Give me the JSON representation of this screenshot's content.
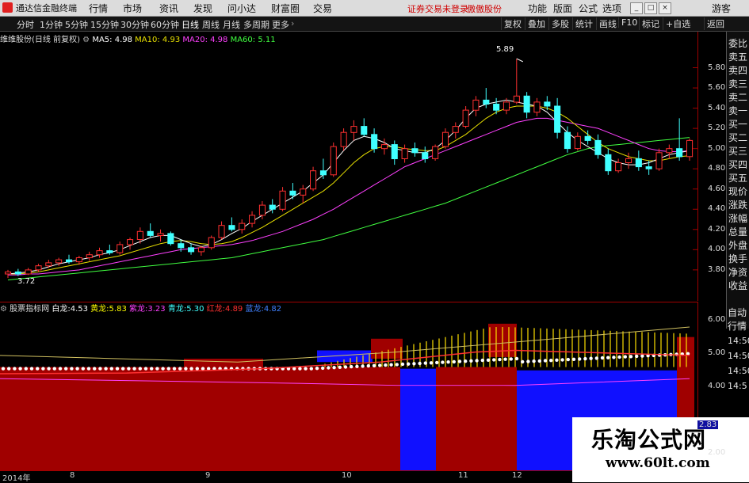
{
  "menubar": {
    "app_title": "通达信金融终端",
    "items": [
      "行情",
      "市场",
      "资讯",
      "发现",
      "问小达",
      "财富圈",
      "交易"
    ],
    "notice": "证券交易未登录",
    "stock_hint": "傲傲股份",
    "right_items": [
      "功能",
      "版面",
      "公式",
      "选项"
    ],
    "guest": "游客"
  },
  "periodbar": {
    "periods": [
      "分时",
      "1分钟",
      "5分钟",
      "15分钟",
      "30分钟",
      "60分钟",
      "日线",
      "周线",
      "月线",
      "多周期",
      "更多"
    ],
    "active": "日线",
    "tools": [
      "复权",
      "叠加",
      "多股",
      "统计",
      "画线",
      "F10",
      "标记",
      "+自选",
      "返回"
    ]
  },
  "side_panel": [
    "委比",
    "卖五",
    "卖四",
    "卖三",
    "卖二",
    "卖一",
    "买一",
    "买二",
    "买三",
    "买四",
    "买五",
    "现价",
    "涨跌",
    "涨幅",
    "总量",
    "外盘",
    "换手",
    "净资",
    "收益"
  ],
  "side_panel2": [
    "自动",
    "行情"
  ],
  "side_times": [
    "14:50",
    "14:50",
    "14:50",
    "14:5"
  ],
  "main_legend": {
    "name": "维维股份(日线 前复权)",
    "ma5_label": "MA5: 4.98",
    "ma10_label": "MA10: 4.93",
    "ma20_label": "MA20: 4.98",
    "ma60_label": "MA60: 5.11",
    "colors": {
      "ma5": "#ffffff",
      "ma10": "#e8e000",
      "ma20": "#ff40ff",
      "ma60": "#40ff40"
    }
  },
  "price_axis": [
    "5.80",
    "5.60",
    "5.40",
    "5.20",
    "5.00",
    "4.80",
    "4.60",
    "4.40",
    "4.20",
    "4.00",
    "3.80"
  ],
  "annotations": {
    "high": "5.89",
    "low": "3.72"
  },
  "indicator_legend": {
    "name": "股票指标网",
    "items": [
      {
        "label": "白龙:",
        "value": "4.53",
        "color": "#ffffff"
      },
      {
        "label": "黄龙:",
        "value": "5.83",
        "color": "#ffff00"
      },
      {
        "label": "紫龙:",
        "value": "3.23",
        "color": "#ff40ff"
      },
      {
        "label": "青龙:",
        "value": "5.30",
        "color": "#40ffff"
      },
      {
        "label": "红龙:",
        "value": "4.89",
        "color": "#ff3030"
      },
      {
        "label": "蓝龙:",
        "value": "4.82",
        "color": "#4080ff"
      }
    ]
  },
  "indicator_axis": [
    "6.00",
    "5.00",
    "4.00",
    "2.83",
    "2.00"
  ],
  "dates": [
    "2014年",
    "8",
    "9",
    "10",
    "11",
    "12"
  ],
  "watermark": {
    "title": "乐淘公式网",
    "url": "www.60lt.com"
  },
  "chart_data": {
    "type": "candlestick",
    "ylim": [
      3.65,
      6.0
    ],
    "up_color": "#ff3030",
    "down_color": "#40ffff",
    "ohlc": [
      [
        3.76,
        3.8,
        3.72,
        3.78
      ],
      [
        3.78,
        3.81,
        3.74,
        3.76
      ],
      [
        3.76,
        3.82,
        3.75,
        3.8
      ],
      [
        3.8,
        3.86,
        3.78,
        3.84
      ],
      [
        3.84,
        3.9,
        3.82,
        3.87
      ],
      [
        3.87,
        3.92,
        3.84,
        3.9
      ],
      [
        3.9,
        3.95,
        3.86,
        3.88
      ],
      [
        3.88,
        3.94,
        3.85,
        3.92
      ],
      [
        3.92,
        3.98,
        3.89,
        3.95
      ],
      [
        3.95,
        4.02,
        3.92,
        3.99
      ],
      [
        3.99,
        4.05,
        3.95,
        3.97
      ],
      [
        3.97,
        4.08,
        3.95,
        4.05
      ],
      [
        4.05,
        4.12,
        4.0,
        4.1
      ],
      [
        4.1,
        4.22,
        4.06,
        4.18
      ],
      [
        4.18,
        4.26,
        4.12,
        4.14
      ],
      [
        4.14,
        4.2,
        4.08,
        4.16
      ],
      [
        4.16,
        4.18,
        4.04,
        4.06
      ],
      [
        4.06,
        4.1,
        3.98,
        4.02
      ],
      [
        4.02,
        4.06,
        3.95,
        3.98
      ],
      [
        3.98,
        4.04,
        3.94,
        4.02
      ],
      [
        4.02,
        4.14,
        4.0,
        4.12
      ],
      [
        4.12,
        4.28,
        4.1,
        4.24
      ],
      [
        4.24,
        4.32,
        4.18,
        4.2
      ],
      [
        4.2,
        4.3,
        4.16,
        4.26
      ],
      [
        4.26,
        4.38,
        4.22,
        4.34
      ],
      [
        4.34,
        4.48,
        4.3,
        4.44
      ],
      [
        4.44,
        4.5,
        4.36,
        4.4
      ],
      [
        4.4,
        4.62,
        4.38,
        4.58
      ],
      [
        4.58,
        4.66,
        4.5,
        4.54
      ],
      [
        4.54,
        4.64,
        4.46,
        4.6
      ],
      [
        4.6,
        4.82,
        4.58,
        4.78
      ],
      [
        4.78,
        4.9,
        4.7,
        4.74
      ],
      [
        4.74,
        5.06,
        4.72,
        5.02
      ],
      [
        5.02,
        5.2,
        4.98,
        5.16
      ],
      [
        5.16,
        5.28,
        5.08,
        5.22
      ],
      [
        5.22,
        5.3,
        5.12,
        5.14
      ],
      [
        5.14,
        5.2,
        4.96,
        5.0
      ],
      [
        5.0,
        5.1,
        4.94,
        5.04
      ],
      [
        5.04,
        5.08,
        4.84,
        4.9
      ],
      [
        4.9,
        5.04,
        4.86,
        5.0
      ],
      [
        5.0,
        5.06,
        4.92,
        4.96
      ],
      [
        4.96,
        5.02,
        4.86,
        4.9
      ],
      [
        4.9,
        5.04,
        4.88,
        5.02
      ],
      [
        5.02,
        5.2,
        5.0,
        5.16
      ],
      [
        5.16,
        5.26,
        5.1,
        5.22
      ],
      [
        5.22,
        5.42,
        5.2,
        5.38
      ],
      [
        5.38,
        5.52,
        5.32,
        5.48
      ],
      [
        5.48,
        5.6,
        5.4,
        5.44
      ],
      [
        5.44,
        5.5,
        5.34,
        5.38
      ],
      [
        5.38,
        5.5,
        5.34,
        5.46
      ],
      [
        5.46,
        5.89,
        5.44,
        5.52
      ],
      [
        5.52,
        5.56,
        5.3,
        5.36
      ],
      [
        5.36,
        5.5,
        5.32,
        5.46
      ],
      [
        5.46,
        5.52,
        5.38,
        5.42
      ],
      [
        5.42,
        5.5,
        5.1,
        5.16
      ],
      [
        5.16,
        5.22,
        4.96,
        5.0
      ],
      [
        5.0,
        5.16,
        4.98,
        5.12
      ],
      [
        5.12,
        5.18,
        5.04,
        5.08
      ],
      [
        5.08,
        5.14,
        4.9,
        4.94
      ],
      [
        4.94,
        5.0,
        4.74,
        4.78
      ],
      [
        4.78,
        4.9,
        4.76,
        4.86
      ],
      [
        4.86,
        4.96,
        4.8,
        4.9
      ],
      [
        4.9,
        4.98,
        4.78,
        4.82
      ],
      [
        4.82,
        4.88,
        4.74,
        4.8
      ],
      [
        4.8,
        5.0,
        4.78,
        4.96
      ],
      [
        4.96,
        5.04,
        4.9,
        5.0
      ],
      [
        5.0,
        5.3,
        4.88,
        4.92
      ],
      [
        4.92,
        5.1,
        4.88,
        5.08
      ]
    ],
    "ma": {
      "ma5": [
        3.76,
        3.77,
        3.78,
        3.8,
        3.83,
        3.86,
        3.88,
        3.9,
        3.92,
        3.95,
        3.97,
        4.0,
        4.04,
        4.08,
        4.12,
        4.14,
        4.14,
        4.1,
        4.06,
        4.03,
        4.05,
        4.1,
        4.16,
        4.21,
        4.28,
        4.34,
        4.4,
        4.46,
        4.52,
        4.58,
        4.66,
        4.74,
        4.86,
        4.98,
        5.08,
        5.12,
        5.1,
        5.06,
        5.0,
        4.98,
        4.96,
        4.96,
        5.0,
        5.08,
        5.18,
        5.3,
        5.4,
        5.44,
        5.46,
        5.48,
        5.46,
        5.44,
        5.42,
        5.36,
        5.26,
        5.16,
        5.08,
        5.02,
        4.96,
        4.9,
        4.86,
        4.84,
        4.84,
        4.86,
        4.9,
        4.94,
        4.96,
        4.98
      ],
      "ma10": [
        3.76,
        3.76,
        3.77,
        3.78,
        3.8,
        3.82,
        3.84,
        3.86,
        3.88,
        3.9,
        3.92,
        3.94,
        3.97,
        4.0,
        4.03,
        4.06,
        4.08,
        4.09,
        4.08,
        4.06,
        4.05,
        4.06,
        4.08,
        4.12,
        4.17,
        4.22,
        4.28,
        4.34,
        4.4,
        4.46,
        4.52,
        4.58,
        4.66,
        4.76,
        4.86,
        4.94,
        5.0,
        5.02,
        5.02,
        5.0,
        4.99,
        4.98,
        4.98,
        5.02,
        5.08,
        5.14,
        5.22,
        5.3,
        5.36,
        5.4,
        5.42,
        5.42,
        5.42,
        5.4,
        5.36,
        5.3,
        5.22,
        5.14,
        5.06,
        5.0,
        4.96,
        4.92,
        4.9,
        4.88,
        4.88,
        4.9,
        4.92,
        4.93
      ],
      "ma20": [
        3.75,
        3.75,
        3.76,
        3.76,
        3.77,
        3.78,
        3.79,
        3.8,
        3.82,
        3.84,
        3.86,
        3.88,
        3.9,
        3.92,
        3.94,
        3.96,
        3.98,
        4.0,
        4.01,
        4.02,
        4.03,
        4.04,
        4.05,
        4.07,
        4.09,
        4.12,
        4.15,
        4.18,
        4.22,
        4.26,
        4.3,
        4.35,
        4.4,
        4.46,
        4.52,
        4.58,
        4.64,
        4.7,
        4.76,
        4.82,
        4.86,
        4.9,
        4.94,
        4.98,
        5.02,
        5.06,
        5.1,
        5.14,
        5.18,
        5.22,
        5.26,
        5.28,
        5.3,
        5.3,
        5.28,
        5.26,
        5.24,
        5.22,
        5.2,
        5.16,
        5.12,
        5.08,
        5.04,
        5.0,
        4.98,
        4.97,
        4.97,
        4.98
      ],
      "ma60": [
        3.7,
        3.71,
        3.72,
        3.73,
        3.74,
        3.75,
        3.76,
        3.77,
        3.78,
        3.79,
        3.8,
        3.81,
        3.82,
        3.83,
        3.84,
        3.85,
        3.86,
        3.87,
        3.88,
        3.89,
        3.9,
        3.91,
        3.92,
        3.94,
        3.96,
        3.98,
        4.0,
        4.02,
        4.04,
        4.06,
        4.08,
        4.1,
        4.13,
        4.16,
        4.19,
        4.22,
        4.25,
        4.28,
        4.31,
        4.34,
        4.37,
        4.4,
        4.43,
        4.46,
        4.5,
        4.54,
        4.58,
        4.62,
        4.66,
        4.7,
        4.74,
        4.78,
        4.82,
        4.86,
        4.9,
        4.94,
        4.97,
        5.0,
        5.02,
        5.03,
        5.04,
        5.05,
        5.06,
        5.07,
        5.08,
        5.09,
        5.1,
        5.11
      ]
    }
  }
}
